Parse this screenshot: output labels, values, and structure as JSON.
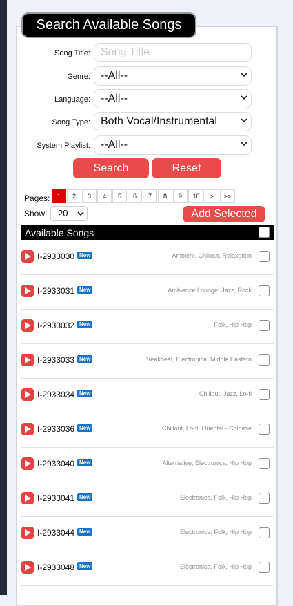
{
  "header": {
    "title": "Search Available Songs"
  },
  "form": {
    "song_title_label": "Song Title:",
    "song_title_placeholder": "Song Title",
    "genre_label": "Genre:",
    "genre_value": "--All--",
    "language_label": "Language:",
    "language_value": "--All--",
    "song_type_label": "Song Type:",
    "song_type_value": "Both Vocal/Instrumental",
    "playlist_label": "System Playlist:",
    "playlist_value": "--All--",
    "search_label": "Search",
    "reset_label": "Reset"
  },
  "pagination": {
    "label": "Pages:",
    "pages": [
      "1",
      "2",
      "3",
      "4",
      "5",
      "6",
      "7",
      "8",
      "9",
      "10",
      ">",
      ">>"
    ],
    "active_page": "1",
    "show_label": "Show:",
    "show_value": "20",
    "add_selected_label": "Add Selected"
  },
  "list": {
    "title": "Available Songs",
    "songs": [
      {
        "id": "I-2933030",
        "badge": "New",
        "genres": "Ambient, Chillout, Relaxation"
      },
      {
        "id": "I-2933031",
        "badge": "New",
        "genres": "Ambience Lounge, Jazz, Rock"
      },
      {
        "id": "I-2933032",
        "badge": "New",
        "genres": "Folk, Hip Hop"
      },
      {
        "id": "I-2933033",
        "badge": "New",
        "genres": "Breakbeat, Electronica, Middle Eastern"
      },
      {
        "id": "I-2933034",
        "badge": "New",
        "genres": "Chillout, Jazz, Lo-fi"
      },
      {
        "id": "I-2933036",
        "badge": "New",
        "genres": "Chillout, Lo-fi, Oriental - Chinese"
      },
      {
        "id": "I-2933040",
        "badge": "New",
        "genres": "Alternative, Electronica, Hip Hop"
      },
      {
        "id": "I-2933041",
        "badge": "New",
        "genres": "Electronica, Folk, Hip Hop"
      },
      {
        "id": "I-2933044",
        "badge": "New",
        "genres": "Electronica, Folk, Hip Hop"
      },
      {
        "id": "I-2933048",
        "badge": "New",
        "genres": "Electronica, Folk, Hip Hop"
      }
    ]
  },
  "colors": {
    "accent": "#e94a4a",
    "badge": "#1a73c8",
    "header_bg": "#000000"
  },
  "icons": {
    "play": "play-icon",
    "caret": "chevron-down-icon"
  }
}
